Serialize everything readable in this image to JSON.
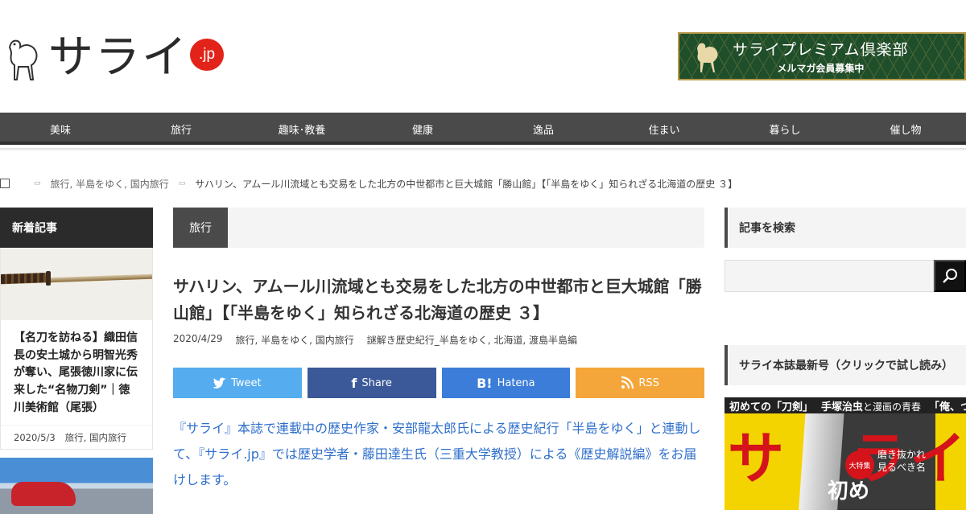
{
  "header": {
    "logo_text": "サライ",
    "logo_badge": ".jp",
    "premium_title": "サライプレミアム倶楽部",
    "premium_sub": "メルマガ会員募集中"
  },
  "nav": {
    "items": [
      "美味",
      "旅行",
      "趣味･教養",
      "健康",
      "逸品",
      "住まい",
      "暮らし",
      "催し物"
    ]
  },
  "breadcrumb": {
    "category": "旅行, 半島をゆく, 国内旅行",
    "current": "サハリン、アムール川流域とも交易をした北方の中世都市と巨大城館「勝山館」【「半島をゆく」知られざる北海道の歴史 ３】"
  },
  "left": {
    "heading": "新着記事",
    "card1_title": "【名刀を訪ねる】織田信長の安土城から明智光秀が奪い、尾張徳川家に伝来した“名物刀剣”｜徳川美術館（尾張）",
    "card1_date": "2020/5/3",
    "card1_cats": "旅行, 国内旅行"
  },
  "main": {
    "category_tab": "旅行",
    "title": "サハリン、アムール川流域とも交易をした北方の中世都市と巨大城館「勝山館」【「半島をゆく」知られざる北海道の歴史 ３】",
    "date": "2020/4/29",
    "cats": "旅行, 半島をゆく, 国内旅行",
    "tags": "謎解き歴史紀行_半島をゆく, 北海道, 渡島半島編",
    "share": {
      "tweet": "Tweet",
      "share": "Share",
      "hatena_icon": "B!",
      "hatena": "Hatena",
      "rss": "RSS"
    },
    "lead": "『サライ』本誌で連載中の歴史作家・安部龍太郎氏による歴史紀行「半島をゆく」と連動して、『サライ.jp』では歴史学者・藤田達生氏（三重大学教授）による《歴史解説編》をお届けします。"
  },
  "right": {
    "search_heading": "記事を検索",
    "search_placeholder": "",
    "magazine_heading": "サライ本誌最新号（クリックで試し読み）",
    "mag_top1": "初めての「刀剣」",
    "mag_top2": "手塚治虫",
    "mag_top2b": "と漫画の青春",
    "mag_top3": "「俺、つしま」",
    "mag_logo": [
      "サ",
      "ラ",
      "イ"
    ],
    "mag_badge": "大特集",
    "mag_copy": "磨き抜かれ\n見るべき名",
    "mag_big": "初め"
  },
  "colors": {
    "nav": "#4a4a4a",
    "accent_red": "#e2231a",
    "link_blue": "#2f6fcb",
    "twitter": "#55acee",
    "facebook": "#3b5998",
    "hatena": "#3b7dd8",
    "rss": "#f5a63a"
  }
}
